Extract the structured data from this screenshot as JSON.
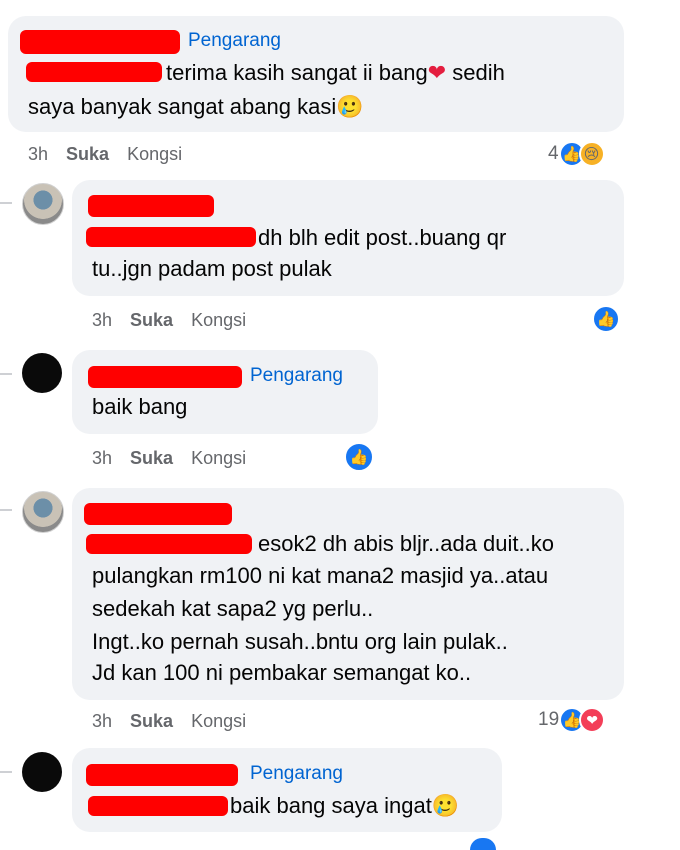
{
  "comments": [
    {
      "author_badge": "Pengarang",
      "text_line1": "terima kasih sangat ii bang",
      "text_line1_suffix": " sedih",
      "text_line2": "saya banyak sangat abang kasi",
      "emoji_heart": "❤",
      "emoji_tear": "🥲",
      "time": "3h",
      "like_label": "Suka",
      "share_label": "Kongsi",
      "reaction_count": "4"
    },
    {
      "text_line1": "dh blh edit post..buang qr",
      "text_line2": "tu..jgn padam post pulak",
      "time": "3h",
      "like_label": "Suka",
      "share_label": "Kongsi"
    },
    {
      "author_badge": "Pengarang",
      "text_line1": "baik bang",
      "time": "3h",
      "like_label": "Suka",
      "share_label": "Kongsi"
    },
    {
      "text_line1": "esok2 dh abis bljr..ada duit..ko",
      "text_line2": "pulangkan rm100 ni kat mana2 masjid ya..atau",
      "text_line3": "sedekah kat sapa2 yg perlu..",
      "text_line4": "Ingt..ko pernah susah..bntu org lain pulak..",
      "text_line5": "Jd kan 100 ni pembakar semangat ko..",
      "time": "3h",
      "like_label": "Suka",
      "share_label": "Kongsi",
      "reaction_count": "19"
    },
    {
      "author_badge": "Pengarang",
      "text_line1": "baik bang saya ingat",
      "emoji_tear": "🥲"
    }
  ],
  "icons": {
    "like": "👍",
    "sad": "😢",
    "love": "❤"
  },
  "colors": {
    "bubble": "#f0f2f5",
    "redaction": "#ff0000",
    "link": "#0064d1",
    "like_blue": "#1877f2"
  }
}
